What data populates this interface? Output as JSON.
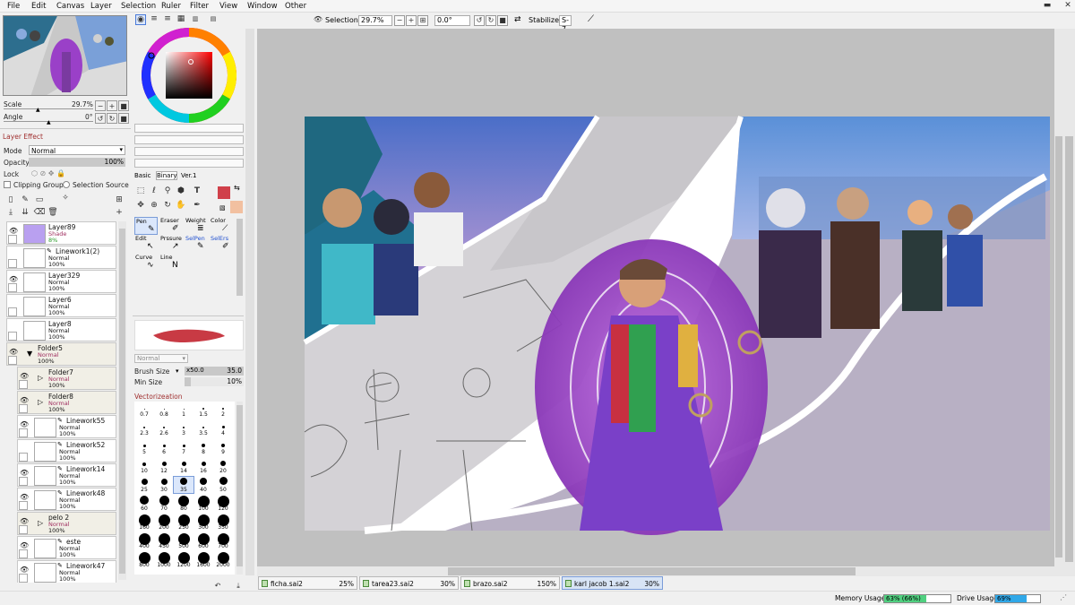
{
  "menu": [
    "File",
    "Edit",
    "Canvas",
    "Layer",
    "Selection",
    "Ruler",
    "Filter",
    "View",
    "Window",
    "Other"
  ],
  "toolbar": {
    "selection_label": "Selection",
    "zoom": "29.7%",
    "rotation": "0.0°",
    "stabilizer_label": "Stabilizer",
    "stabilizer_value": "S-7"
  },
  "navigator": {
    "scale_label": "Scale",
    "scale_value": "29.7%",
    "angle_label": "Angle",
    "angle_value": "0°"
  },
  "layer_panel": {
    "effect_header": "Layer Effect",
    "mode_label": "Mode",
    "mode_value": "Normal",
    "opacity_label": "Opacity",
    "opacity_value": "100%",
    "lock_label": "Lock",
    "clipping_label": "Clipping Group",
    "selection_source_label": "Selection Source",
    "layers": [
      {
        "name": "Layer89",
        "mode": "Shade",
        "opacity": "8%",
        "visible": true,
        "type": "layer",
        "thumb": "#b9a0f0",
        "sub": false
      },
      {
        "name": "Linework1(2)",
        "mode": "Normal",
        "opacity": "100%",
        "visible": false,
        "type": "linework",
        "thumb": "#ffffff",
        "sub": false
      },
      {
        "name": "Layer329",
        "mode": "Normal",
        "opacity": "100%",
        "visible": true,
        "type": "layer",
        "thumb": "#ffffff",
        "sub": false
      },
      {
        "name": "Layer6",
        "mode": "Normal",
        "opacity": "100%",
        "visible": false,
        "type": "layer",
        "thumb": "#ffffff",
        "sub": false
      },
      {
        "name": "Layer8",
        "mode": "Normal",
        "opacity": "100%",
        "visible": false,
        "type": "layer",
        "thumb": "#ffffff",
        "sub": false
      },
      {
        "name": "Folder5",
        "mode": "Normal",
        "opacity": "100%",
        "visible": true,
        "type": "folder",
        "thumb": "",
        "sub": false
      },
      {
        "name": "Folder7",
        "mode": "Normal",
        "opacity": "100%",
        "visible": true,
        "type": "folder",
        "thumb": "",
        "sub": true
      },
      {
        "name": "Folder8",
        "mode": "Normal",
        "opacity": "100%",
        "visible": true,
        "type": "folder",
        "thumb": "",
        "sub": true
      },
      {
        "name": "Linework55",
        "mode": "Normal",
        "opacity": "100%",
        "visible": true,
        "type": "linework",
        "thumb": "#ffffff",
        "sub": true
      },
      {
        "name": "Linework52",
        "mode": "Normal",
        "opacity": "100%",
        "visible": false,
        "type": "linework",
        "thumb": "#ffffff",
        "sub": true
      },
      {
        "name": "Linework14",
        "mode": "Normal",
        "opacity": "100%",
        "visible": true,
        "type": "linework",
        "thumb": "#ffffff",
        "sub": true
      },
      {
        "name": "Linework48",
        "mode": "Normal",
        "opacity": "100%",
        "visible": true,
        "type": "linework",
        "thumb": "#ffffff",
        "sub": true
      },
      {
        "name": "pelo 2",
        "mode": "Normal",
        "opacity": "100%",
        "visible": true,
        "type": "folder",
        "thumb": "",
        "sub": true
      },
      {
        "name": "este",
        "mode": "Normal",
        "opacity": "100%",
        "visible": true,
        "type": "linework",
        "thumb": "#ffffff",
        "sub": true
      },
      {
        "name": "Linework47",
        "mode": "Normal",
        "opacity": "100%",
        "visible": true,
        "type": "linework",
        "thumb": "#ffffff",
        "sub": true
      }
    ]
  },
  "tool_panel": {
    "tabs": [
      "Basic",
      "Binary",
      "Ver.1"
    ],
    "tools_row1": [
      "Pen",
      "Eraser",
      "Weight",
      "Color"
    ],
    "tools_row2": [
      "Edit",
      "Prssure",
      "SelPen",
      "SelErs"
    ],
    "tools_row3": [
      "Curve",
      "Line"
    ],
    "blend_mode": "Normal",
    "brush_size_label": "Brush Size",
    "brush_size_mult": "x50.0",
    "brush_size_value": "35.0",
    "min_size_label": "Min Size",
    "min_size_value": "10%",
    "vectorize_label": "Vectorizeation",
    "brush_sizes": [
      "0.7",
      "0.8",
      "1",
      "1.5",
      "2",
      "2.3",
      "2.6",
      "3",
      "3.5",
      "4",
      "5",
      "6",
      "7",
      "8",
      "9",
      "10",
      "12",
      "14",
      "16",
      "20",
      "25",
      "30",
      "35",
      "40",
      "50",
      "60",
      "70",
      "80",
      "100",
      "120",
      "160",
      "200",
      "250",
      "300",
      "350",
      "400",
      "450",
      "500",
      "600",
      "700",
      "800",
      "1000",
      "1200",
      "1600",
      "2000"
    ],
    "selected_brush": "35",
    "main_color": "#d0404a",
    "sub_color": "#f2c0a0"
  },
  "files": [
    {
      "name": "ficha.sai2",
      "zoom": "25%",
      "active": false
    },
    {
      "name": "tarea23.sai2",
      "zoom": "30%",
      "active": false
    },
    {
      "name": "brazo.sai2",
      "zoom": "150%",
      "active": false
    },
    {
      "name": "karl jacob 1.sai2",
      "zoom": "30%",
      "active": true
    }
  ],
  "status": {
    "memory_label": "Memory Usage",
    "memory_value": "63% (66%)",
    "memory_fraction": 0.63,
    "drive_label": "Drive Usage",
    "drive_value": "69%",
    "drive_fraction": 0.69
  }
}
